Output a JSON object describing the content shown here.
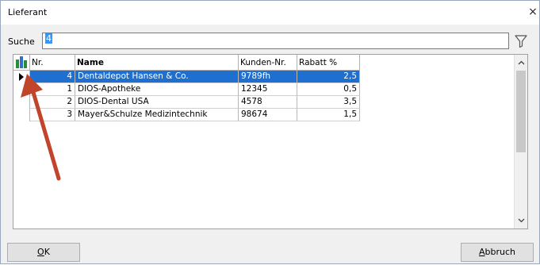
{
  "window": {
    "title": "Lieferant",
    "close_glyph": "×"
  },
  "search": {
    "label": "Suche",
    "value": "4"
  },
  "grid": {
    "columns": [
      "Nr.",
      "Name",
      "Kunden-Nr.",
      "Rabatt %"
    ],
    "rows": [
      {
        "nr": "4",
        "name": "Dentaldepot Hansen & Co.",
        "kunden_nr": "9789fh",
        "rabatt": "2,5",
        "selected": true
      },
      {
        "nr": "1",
        "name": "DIOS-Apotheke",
        "kunden_nr": "12345",
        "rabatt": "0,5",
        "selected": false
      },
      {
        "nr": "2",
        "name": "DIOS-Dental USA",
        "kunden_nr": "4578",
        "rabatt": "3,5",
        "selected": false
      },
      {
        "nr": "3",
        "name": "Mayer&Schulze Medizintechnik",
        "kunden_nr": "98674",
        "rabatt": "1,5",
        "selected": false
      }
    ]
  },
  "buttons": {
    "ok_mnemonic": "O",
    "ok_rest": "K",
    "cancel_mnemonic": "A",
    "cancel_rest": "bbruch"
  },
  "colors": {
    "selection": "#1e6fd0",
    "annotation_arrow": "#c0452b"
  },
  "icons": {
    "filter": "funnel",
    "column_chooser": "table-columns",
    "row_indicator": "triangle-right",
    "scroll_up": "chevron-up",
    "scroll_down": "chevron-down"
  }
}
